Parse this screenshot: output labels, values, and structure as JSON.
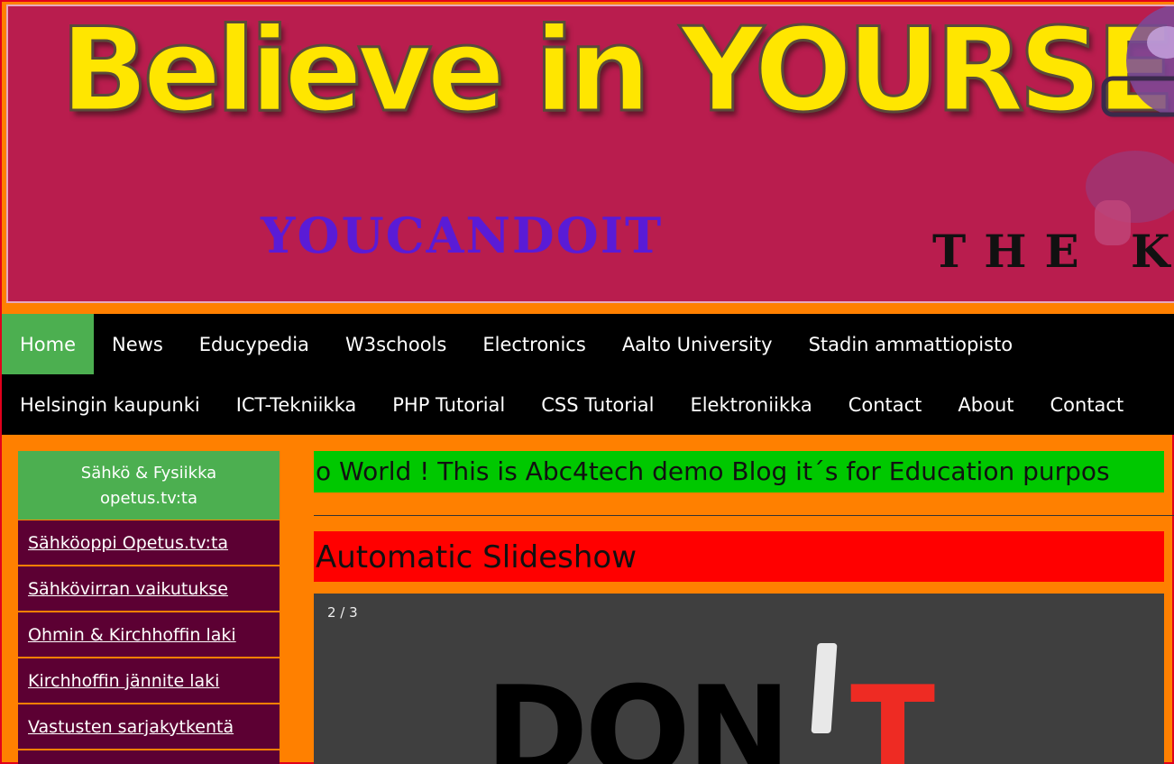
{
  "banner": {
    "title": "Believe in YOURSELF",
    "subtitle": "YOUCANDOIT",
    "tagline": "THE KN"
  },
  "nav": {
    "row1": [
      "Home",
      "News",
      "Educypedia",
      "W3schools",
      "Electronics",
      "Aalto University",
      "Stadin ammattiopisto"
    ],
    "row2": [
      "Helsingin kaupunki",
      "ICT-Tekniikka",
      "PHP Tutorial",
      "CSS Tutorial",
      "Elektroniikka",
      "Contact",
      "About",
      "Contact"
    ],
    "active": "Home"
  },
  "sidebar": {
    "heading_line1": "Sähkö & Fysiikka",
    "heading_line2": "opetus.tv:ta",
    "items": [
      "Sähköoppi Opetus.tv:ta",
      "Sähkövirran vaikutukse",
      "Ohmin & Kirchhoffin laki",
      "Kirchhoffin jännite laki",
      "Vastusten sarjakytkentä",
      ""
    ]
  },
  "main": {
    "marquee_text": "o World ! This is Abc4tech demo Blog it´s for Education purpos",
    "slideshow_title": "Automatic Slideshow",
    "slide_counter": "2 / 3",
    "slide_caption_part1": "DON",
    "slide_caption_part2": "T"
  },
  "colors": {
    "page_bg": "#ff8000",
    "banner_bg": "#b91d4e",
    "nav_bg": "#000000",
    "nav_active": "#4caf50",
    "sidebar_item_bg": "#5c0033",
    "marquee_bg": "#00c800",
    "slideshow_header_bg": "#ff0000"
  }
}
